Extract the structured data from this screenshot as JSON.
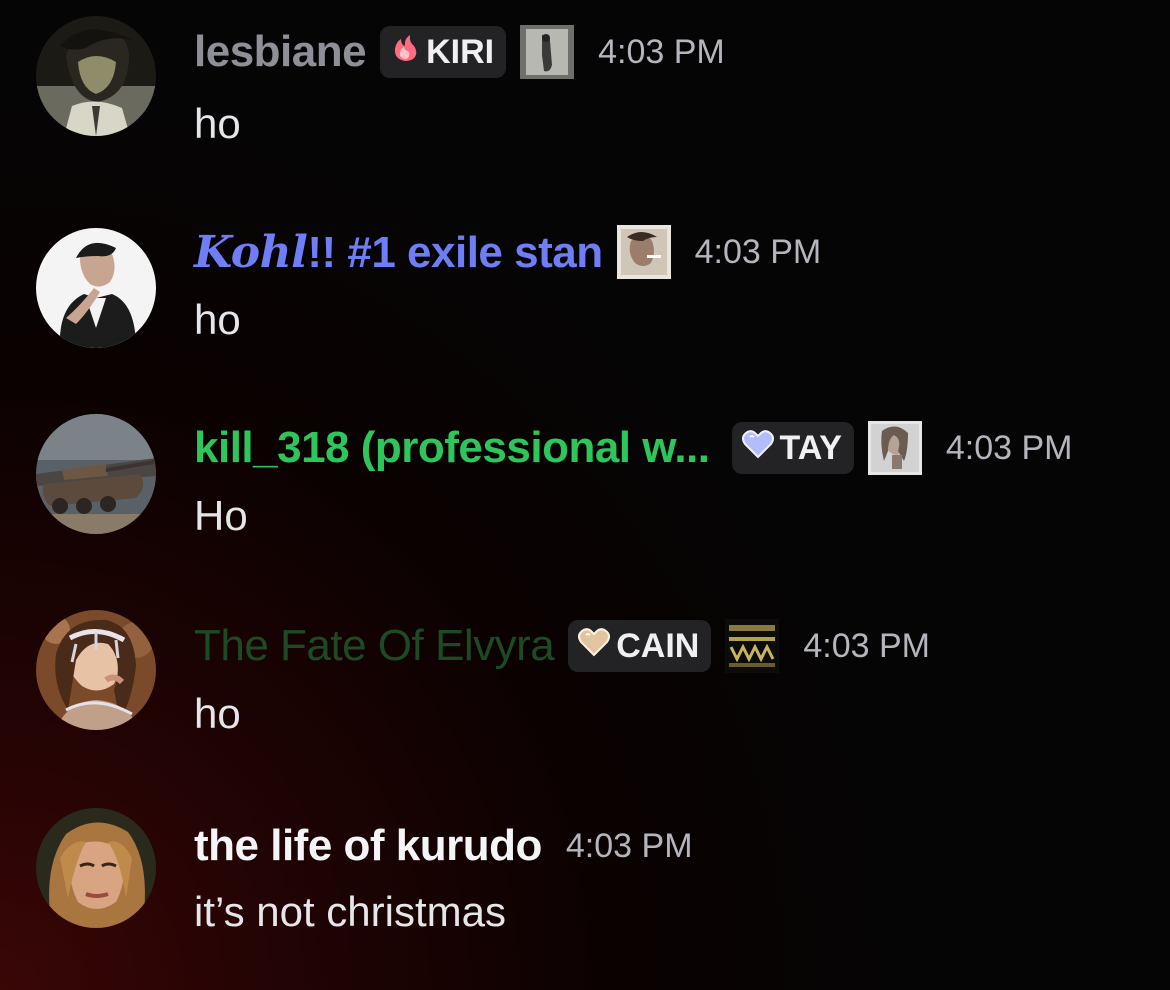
{
  "messages": [
    {
      "username": "lesbiane",
      "username_color": "#8f8f97",
      "badge": {
        "label": "KIRI",
        "icon": "flame-icon",
        "color": "#ff7b8a"
      },
      "timestamp": "4:03 PM",
      "text": "ho"
    },
    {
      "username_script": "Kohl",
      "username": "!! #1 exile stan",
      "username_color": "#6f7ef7",
      "timestamp": "4:03 PM",
      "text": "ho"
    },
    {
      "username": "kill_318 (professional w...",
      "username_color": "#2ec55a",
      "badge": {
        "label": "TAY",
        "icon": "heart-icon",
        "color": "#b9c4ff"
      },
      "timestamp": "4:03 PM",
      "text": "Ho"
    },
    {
      "username": "The Fate Of Elvyra",
      "username_color": "#1d4a22",
      "badge": {
        "label": "CAIN",
        "icon": "heart-icon",
        "color": "#e6cba4"
      },
      "timestamp": "4:03 PM",
      "text": "ho"
    },
    {
      "username": "the life of kurudo",
      "username_color": "#f5f5f7",
      "timestamp": "4:03 PM",
      "text": "it’s not christmas"
    }
  ]
}
